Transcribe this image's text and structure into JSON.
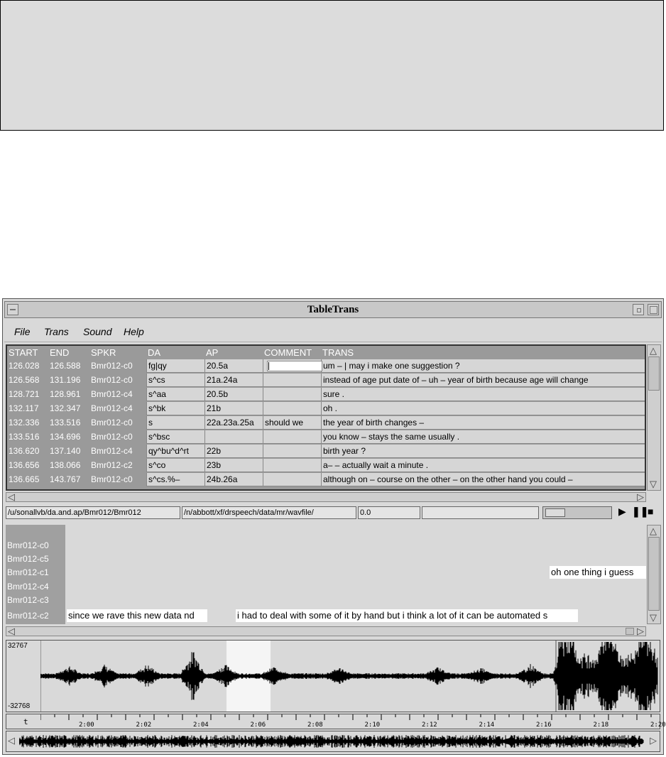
{
  "window": {
    "title": "TableTrans"
  },
  "menu": [
    "File",
    "Trans",
    "Sound",
    "Help"
  ],
  "table": {
    "headers": [
      "START",
      "END",
      "SPKR",
      "DA",
      "AP",
      "COMMENT",
      "TRANS"
    ],
    "rows": [
      [
        "126.028",
        "126.588",
        "Bmr012-c0",
        "fg|qy",
        "20.5a",
        "",
        "um – | may i make one suggestion ?"
      ],
      [
        "126.568",
        "131.196",
        "Bmr012-c0",
        "s^cs",
        "21a.24a",
        "",
        "instead of age put date of – uh – year of birth because age will change"
      ],
      [
        "128.721",
        "128.961",
        "Bmr012-c4",
        "s^aa",
        "20.5b",
        "",
        "sure ."
      ],
      [
        "132.117",
        "132.347",
        "Bmr012-c4",
        "s^bk",
        "21b",
        "",
        "oh ."
      ],
      [
        "132.336",
        "133.516",
        "Bmr012-c0",
        "s",
        "22a.23a.25a",
        "should we",
        "the year of birth changes –"
      ],
      [
        "133.516",
        "134.696",
        "Bmr012-c0",
        "s^bsc",
        "",
        "",
        "you know – stays the same usually ."
      ],
      [
        "136.620",
        "137.140",
        "Bmr012-c4",
        "qy^bu^d^rt",
        "22b",
        "",
        "birth year ?"
      ],
      [
        "136.656",
        "138.066",
        "Bmr012-c2",
        "s^co",
        "23b",
        "",
        "a– – actually wait a minute ."
      ],
      [
        "136.665",
        "143.767",
        "Bmr012-c0",
        "s^cs.%–",
        "24b.26a",
        "",
        "although on – course on the other – on the other hand you could –"
      ]
    ]
  },
  "paths": {
    "transcript": "/u/sonallvb/da.and.ap/Bmr012/Bmr012",
    "wavefile": "/n/abbott/xf/drspeech/data/mr/wavfile/",
    "time": "0.0"
  },
  "speakers": [
    "Bmr012-c0",
    "Bmr012-c5",
    "Bmr012-c1",
    "Bmr012-c4",
    "Bmr012-c3",
    "Bmr012-c2"
  ],
  "lane_segments": {
    "c1_right": "oh one thing i guess",
    "c2_a": "since we rave this new data nd",
    "c2_b": "i had to deal with some of it by hand but i think a lot of it can be automated s"
  },
  "waveform": {
    "ymax": "32767",
    "ymin": "-32768"
  },
  "ruler": {
    "left_label": "t",
    "labels": [
      "2:00",
      "2:02",
      "2:04",
      "2:06",
      "2:08",
      "2:10",
      "2:12",
      "2:14",
      "2:16",
      "2:18",
      "2:20"
    ]
  },
  "colors": {
    "panel": "#d9d9d9",
    "header_dark": "#9a9a9a",
    "selection": "#f5f5f5"
  },
  "icons": [
    "play-icon",
    "pause-icon",
    "stop-icon",
    "scroll-up-arrow",
    "scroll-down-arrow",
    "scroll-left-arrow",
    "scroll-right-arrow"
  ]
}
